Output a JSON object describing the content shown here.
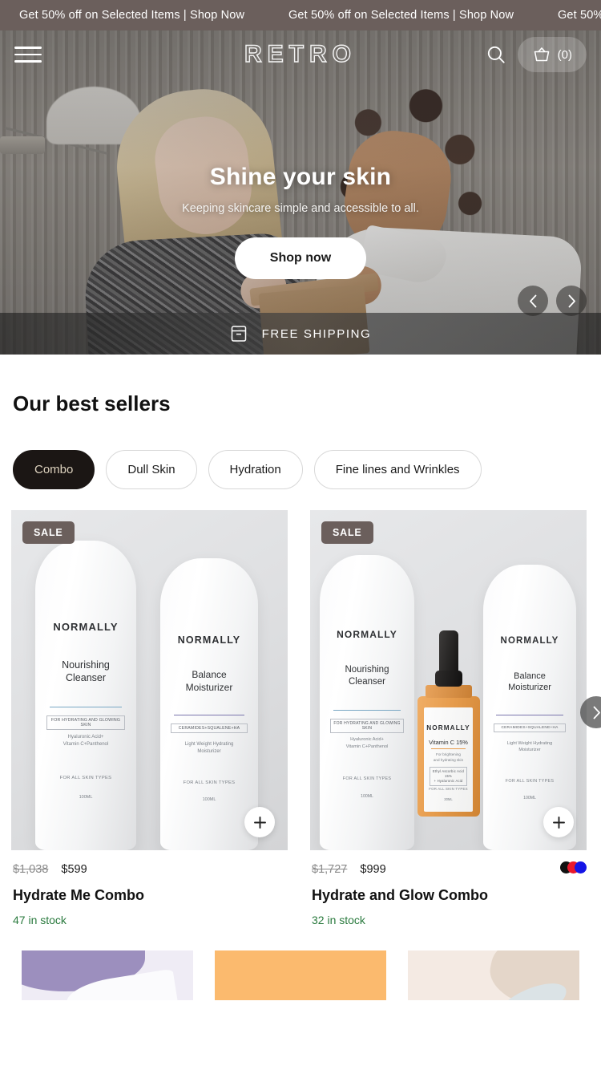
{
  "announcement": {
    "messages": [
      "Get 50% off on Selected Items | Shop Now",
      "Get 50% off on Selected Items | Shop Now",
      "Get 50%"
    ],
    "bg_color": "#6b5f5c"
  },
  "header": {
    "menu_icon": "hamburger-menu-icon",
    "logo": "RETRO",
    "search_icon": "search-icon",
    "cart_icon": "shopping-basket-icon",
    "cart_count": "(0)"
  },
  "hero": {
    "title": "Shine your skin",
    "subtitle": "Keeping skincare simple and accessible to all.",
    "cta": "Shop now",
    "prev_arrow": "chevron-left-icon",
    "next_arrow": "chevron-right-icon",
    "shipping_icon": "package-box-icon",
    "shipping_text": "FREE SHIPPING"
  },
  "best_sellers": {
    "title": "Our best sellers",
    "tabs": [
      {
        "label": "Combo",
        "active": true
      },
      {
        "label": "Dull Skin",
        "active": false
      },
      {
        "label": "Hydration",
        "active": false
      },
      {
        "label": "Fine lines and Wrinkles",
        "active": false
      }
    ],
    "active_tab_bg": "#1b1614",
    "active_tab_color": "#ddd2be",
    "next_arrow": "chevron-right-icon",
    "products": [
      {
        "badge": "SALE",
        "price_was": "$1,038",
        "price_now": "$599",
        "name": "Hydrate Me Combo",
        "stock": "47 in stock",
        "add_icon": "plus-icon",
        "swatches": [],
        "items": [
          {
            "brand": "NORMALLY",
            "product": "Nourishing\nCleanser",
            "claim": "FOR HYDRATING AND GLOWING SKIN",
            "ingredients": "Hyaluronic Acid+\nVitamin C+Panthenol",
            "skin_types": "FOR ALL SKIN TYPES",
            "volume": "100ML",
            "accent": "#79a7c4"
          },
          {
            "brand": "NORMALLY",
            "product": "Balance\nMoisturizer",
            "claim": "CERAMIDES+SQUALENE+HA",
            "ingredients": "Light Weight Hydrating\nMoisturizer",
            "skin_types": "FOR ALL SKIN TYPES",
            "volume": "100ML",
            "accent": "#7b76ad"
          }
        ]
      },
      {
        "badge": "SALE",
        "price_was": "$1,727",
        "price_now": "$999",
        "name": "Hydrate and Glow Combo",
        "stock": "32 in stock",
        "add_icon": "plus-icon",
        "swatches": [
          "#111111",
          "#e8192c",
          "#1414e6"
        ],
        "items": [
          {
            "brand": "NORMALLY",
            "product": "Nourishing\nCleanser",
            "claim": "FOR HYDRATING AND GLOWING SKIN",
            "ingredients": "Hyaluronic Acid+\nVitamin C+Panthenol",
            "skin_types": "FOR ALL SKIN TYPES",
            "volume": "100ML",
            "accent": "#79a7c4"
          },
          {
            "brand": "NORMALLY",
            "product": "Balance\nMoisturizer",
            "claim": "CERAMIDES+SQUALENE+HA",
            "ingredients": "Light Weight Hydrating\nMoisturizer",
            "skin_types": "FOR ALL SKIN TYPES",
            "volume": "100ML",
            "accent": "#7b76ad"
          }
        ],
        "serum": {
          "brand": "NORMALLY",
          "product": "Vitamin C 15%",
          "ingredients": "For brightening\nand hydrating skin",
          "claim": "Ethyl Ascorbic Acid 15%\n+ Hyaluronic Acid",
          "skin_types": "FOR ALL SKIN TYPES",
          "volume": "30ML",
          "accent": "#e79d4e"
        }
      }
    ]
  },
  "bottom_cards": [
    {
      "name": "card-lavender",
      "color": "#9c8fbe"
    },
    {
      "name": "card-orange",
      "color": "#fbba6e"
    },
    {
      "name": "card-beige",
      "color": "#f4eae3"
    }
  ]
}
